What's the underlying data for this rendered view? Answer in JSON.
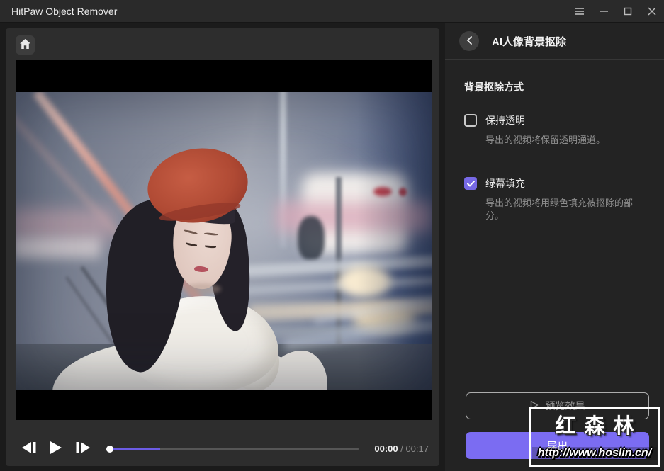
{
  "window": {
    "title": "HitPaw Object Remover"
  },
  "titlebar": {
    "icons": [
      "menu-icon",
      "minimize-icon",
      "maximize-icon",
      "close-icon"
    ]
  },
  "left_panel": {
    "home_icon": "home-icon",
    "player": {
      "prev_frame_icon": "previous-frame-icon",
      "play_icon": "play-icon",
      "next_frame_icon": "next-frame-icon",
      "current_time": "00:00",
      "time_separator": " / ",
      "duration": "00:17",
      "playhead_percent": 0,
      "highlight_percent": 21
    }
  },
  "right_panel": {
    "back_icon": "back-chevron-icon",
    "title": "AI人像背景抠除",
    "section_title": "背景抠除方式",
    "options": [
      {
        "label": "保持透明",
        "description": "导出的视频将保留透明通道。",
        "checked": false
      },
      {
        "label": "绿幕填充",
        "description": "导出的视频将用绿色填充被抠除的部分。",
        "checked": true
      }
    ],
    "preview_button": "预览效果",
    "export_button": "导出"
  },
  "watermark": {
    "name": "红森林",
    "url": "http://www.hoslin.cn/"
  },
  "colors": {
    "accent_purple": "#7769e6",
    "export_button": "#7b6cf2",
    "progress_fill": "#6c5ce4",
    "panel_background": "#232323",
    "titlebar_background": "#2a2a2a"
  }
}
